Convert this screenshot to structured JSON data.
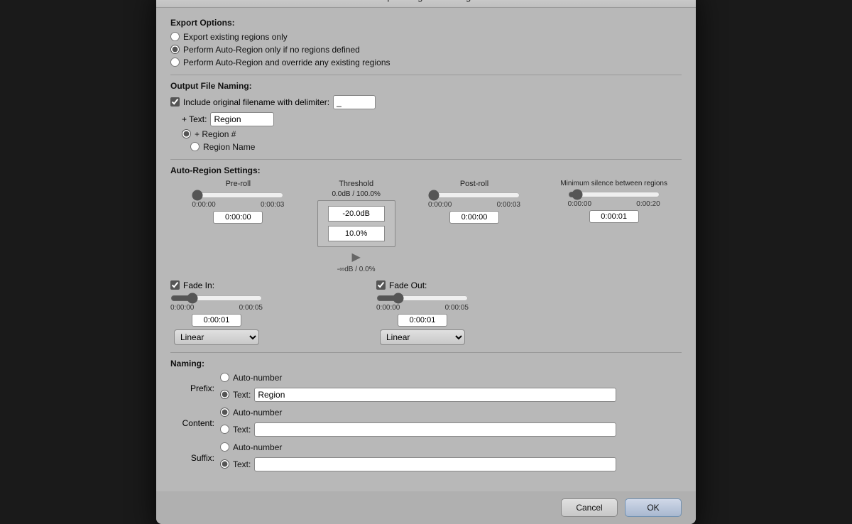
{
  "title": "Export Regions Settings",
  "export_options": {
    "label": "Export Options:",
    "options": [
      {
        "id": "opt1",
        "label": "Export existing regions only",
        "checked": false
      },
      {
        "id": "opt2",
        "label": "Perform Auto-Region only if no regions defined",
        "checked": true
      },
      {
        "id": "opt3",
        "label": "Perform Auto-Region and override any existing regions",
        "checked": false
      }
    ]
  },
  "output_naming": {
    "label": "Output File Naming:",
    "include_filename_label": "Include original filename with delimiter:",
    "delimiter_value": "_",
    "text_label": "+ Text:",
    "text_value": "Region",
    "region_number_label": "+ Region #",
    "region_name_label": "Region Name"
  },
  "auto_region": {
    "label": "Auto-Region Settings:",
    "pre_roll": {
      "title": "Pre-roll",
      "min": "0:00:00",
      "max": "0:00:03",
      "value": "0:00:00"
    },
    "threshold": {
      "title": "Threshold",
      "top_label": "0.0dB / 100.0%",
      "db_value": "-20.0dB",
      "pct_value": "10.0%",
      "bottom_label": "-∞dB / 0.0%"
    },
    "post_roll": {
      "title": "Post-roll",
      "min": "0:00:00",
      "max": "0:00:03",
      "value": "0:00:00"
    },
    "min_silence": {
      "title": "Minimum silence between regions",
      "min": "0:00:00",
      "max": "0:00:20",
      "value": "0:00:01"
    }
  },
  "fade_in": {
    "label": "Fade In:",
    "min": "0:00:00",
    "max": "0:00:05",
    "value": "0:00:01",
    "type": "Linear"
  },
  "fade_out": {
    "label": "Fade Out:",
    "min": "0:00:00",
    "max": "0:00:05",
    "value": "0:00:01",
    "type": "Linear"
  },
  "naming": {
    "label": "Naming:",
    "prefix": {
      "key": "Prefix:",
      "auto_number_label": "Auto-number",
      "text_label": "Text:",
      "text_value": "Region"
    },
    "content": {
      "key": "Content:",
      "auto_number_label": "Auto-number",
      "text_label": "Text:",
      "text_value": ""
    },
    "suffix": {
      "key": "Suffix:",
      "auto_number_label": "Auto-number",
      "text_label": "Text:",
      "text_value": ""
    }
  },
  "buttons": {
    "cancel": "Cancel",
    "ok": "OK"
  }
}
